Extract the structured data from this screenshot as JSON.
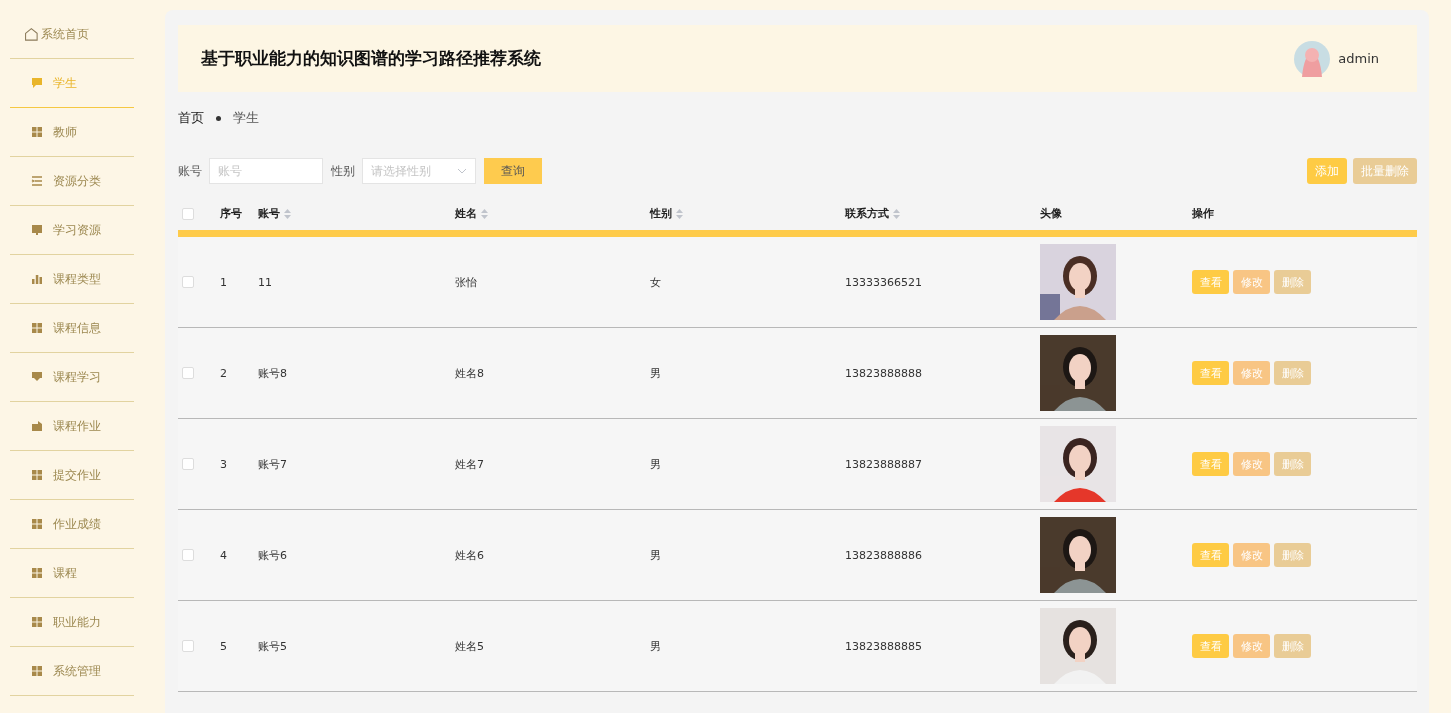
{
  "sidebar": {
    "items": [
      {
        "label": "系统首页",
        "kind": "home",
        "selected": false
      },
      {
        "label": "学生",
        "kind": "chat",
        "selected": true
      },
      {
        "label": "教师",
        "kind": "grid",
        "selected": false
      },
      {
        "label": "资源分类",
        "kind": "list",
        "selected": false
      },
      {
        "label": "学习资源",
        "kind": "monitor",
        "selected": false
      },
      {
        "label": "课程类型",
        "kind": "chart",
        "selected": false
      },
      {
        "label": "课程信息",
        "kind": "grid",
        "selected": false
      },
      {
        "label": "课程学习",
        "kind": "stand",
        "selected": false
      },
      {
        "label": "课程作业",
        "kind": "case",
        "selected": false
      },
      {
        "label": "提交作业",
        "kind": "grid",
        "selected": false
      },
      {
        "label": "作业成绩",
        "kind": "grid",
        "selected": false
      },
      {
        "label": "课程",
        "kind": "grid",
        "selected": false
      },
      {
        "label": "职业能力",
        "kind": "grid",
        "selected": false
      },
      {
        "label": "系统管理",
        "kind": "grid",
        "selected": false
      }
    ]
  },
  "header": {
    "title": "基于职业能力的知识图谱的学习路径推荐系统",
    "user": "admin"
  },
  "breadcrumb": [
    "首页",
    "学生"
  ],
  "search": {
    "fields": [
      {
        "label": "账号",
        "kind": "input",
        "placeholder": "账号"
      },
      {
        "label": "性别",
        "kind": "select",
        "placeholder": "请选择性别"
      }
    ],
    "button": "查询"
  },
  "actions": [
    {
      "label": "添加",
      "kind": "add"
    },
    {
      "label": "批量删除",
      "kind": "batch"
    }
  ],
  "table": {
    "select_all": {
      "checked": false
    },
    "columns": [
      {
        "label": "序号",
        "sortable": false
      },
      {
        "label": "账号",
        "sortable": true
      },
      {
        "label": "姓名",
        "sortable": true
      },
      {
        "label": "性别",
        "sortable": true
      },
      {
        "label": "联系方式",
        "sortable": true
      },
      {
        "label": "头像",
        "sortable": false
      },
      {
        "label": "操作",
        "sortable": false
      }
    ],
    "rows": [
      {
        "checked": false,
        "cells": [
          "1",
          "11",
          "张怡",
          "女",
          "13333366521"
        ],
        "buttons": [
          {
            "label": "查看",
            "kind": "view"
          },
          {
            "label": "修改",
            "kind": "edit"
          },
          {
            "label": "删除",
            "kind": "delete"
          }
        ]
      },
      {
        "checked": false,
        "cells": [
          "2",
          "账号8",
          "姓名8",
          "男",
          "13823888888"
        ],
        "buttons": [
          {
            "label": "查看",
            "kind": "view"
          },
          {
            "label": "修改",
            "kind": "edit"
          },
          {
            "label": "删除",
            "kind": "delete"
          }
        ]
      },
      {
        "checked": false,
        "cells": [
          "3",
          "账号7",
          "姓名7",
          "男",
          "13823888887"
        ],
        "buttons": [
          {
            "label": "查看",
            "kind": "view"
          },
          {
            "label": "修改",
            "kind": "edit"
          },
          {
            "label": "删除",
            "kind": "delete"
          }
        ]
      },
      {
        "checked": false,
        "cells": [
          "4",
          "账号6",
          "姓名6",
          "男",
          "13823888886"
        ],
        "buttons": [
          {
            "label": "查看",
            "kind": "view"
          },
          {
            "label": "修改",
            "kind": "edit"
          },
          {
            "label": "删除",
            "kind": "delete"
          }
        ]
      },
      {
        "checked": false,
        "cells": [
          "5",
          "账号5",
          "姓名5",
          "男",
          "13823888885"
        ],
        "buttons": [
          {
            "label": "查看",
            "kind": "view"
          },
          {
            "label": "修改",
            "kind": "edit"
          },
          {
            "label": "删除",
            "kind": "delete"
          }
        ]
      }
    ]
  }
}
